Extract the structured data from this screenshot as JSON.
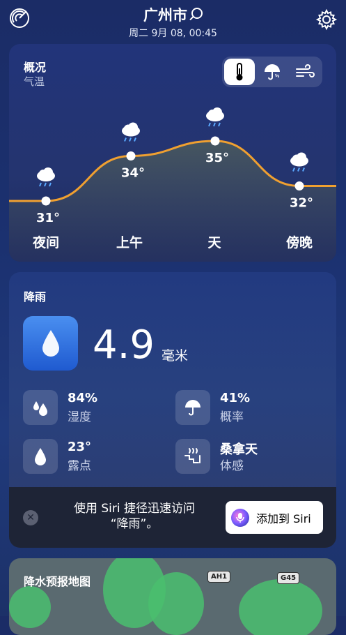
{
  "header": {
    "city": "广州市",
    "datetime": "周二 9月 08, 00:45",
    "radar_icon": "radar-icon",
    "settings_icon": "gear-icon"
  },
  "overview": {
    "title": "概况",
    "subtitle": "气温",
    "segments": [
      "thermometer-icon",
      "umbrella-icon",
      "wind-icon"
    ],
    "active_segment": 0,
    "chart_data": {
      "type": "line",
      "categories": [
        "夜间",
        "上午",
        "天",
        "傍晚"
      ],
      "values": [
        31,
        34,
        35,
        32
      ],
      "labels": [
        "31°",
        "34°",
        "35°",
        "32°"
      ],
      "icons": [
        "rain-cloud-icon",
        "rain-cloud-icon",
        "rain-cloud-icon",
        "rain-cloud-icon"
      ],
      "line_color": "#f0a030"
    }
  },
  "precip": {
    "title": "降雨",
    "value": "4.9",
    "unit": "毫米",
    "metrics": [
      {
        "value": "84%",
        "label": "湿度",
        "icon": "humidity-drops-icon"
      },
      {
        "value": "41%",
        "label": "概率",
        "icon": "umbrella-icon"
      },
      {
        "value": "23°",
        "label": "露点",
        "icon": "dew-drop-icon"
      },
      {
        "value": "桑拿天",
        "label": "体感",
        "icon": "sauna-icon"
      }
    ]
  },
  "siri": {
    "text_line1": "使用 Siri 捷径迅速访问",
    "text_line2": "“降雨”。",
    "button_label": "添加到 Siri"
  },
  "map": {
    "title": "降水预报地图",
    "shield1": "AH1",
    "shield2": "G45"
  },
  "colors": {
    "accent_orange": "#f0a030",
    "drop_blue": "#2d6fe0"
  }
}
